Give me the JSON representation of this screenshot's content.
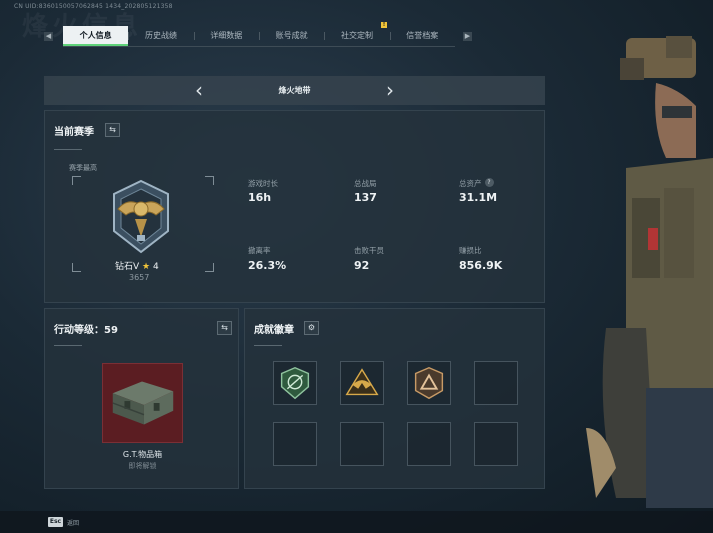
{
  "uid_text": "CN UID:8360150057062845 1434_202805121358",
  "bg_title": "烽火信息",
  "tabs": [
    "个人信息",
    "历史战绩",
    "详细数据",
    "账号成就",
    "社交定制",
    "信誉档案"
  ],
  "tab_badge": "!",
  "map": {
    "name": "烽火地带",
    "prev": "‹",
    "next": "›"
  },
  "season": {
    "title": "当前赛季",
    "swap_icon": "⇆",
    "high_label": "赛季最高",
    "rank_name": "钻石V",
    "rank_star": "★",
    "rank_stars": "4",
    "rank_score": "3657"
  },
  "stats": [
    {
      "label": "游戏时长",
      "value": "16h"
    },
    {
      "label": "总战局",
      "value": "137"
    },
    {
      "label": "总资产",
      "value": "31.1M",
      "help": "?"
    },
    {
      "label": "撤离率",
      "value": "26.3%"
    },
    {
      "label": "击败干员",
      "value": "92"
    },
    {
      "label": "赚损比",
      "value": "856.9K"
    }
  ],
  "action_level": {
    "title": "行动等级：59",
    "swap_icon": "⇆",
    "item_name": "G.T.物品箱",
    "item_status": "即将解锁"
  },
  "badges": {
    "title": "成就徽章",
    "settings_icon": "⚙",
    "slots": [
      "green-shield-badge",
      "gold-eagle-badge",
      "bronze-triangle-badge",
      "",
      "",
      "",
      "",
      ""
    ]
  },
  "footer": {
    "key": "Esc",
    "label": "返回"
  },
  "colors": {
    "accent_green": "#5fd27a",
    "gold": "#f0c43a",
    "item_red": "#5b1d22"
  }
}
